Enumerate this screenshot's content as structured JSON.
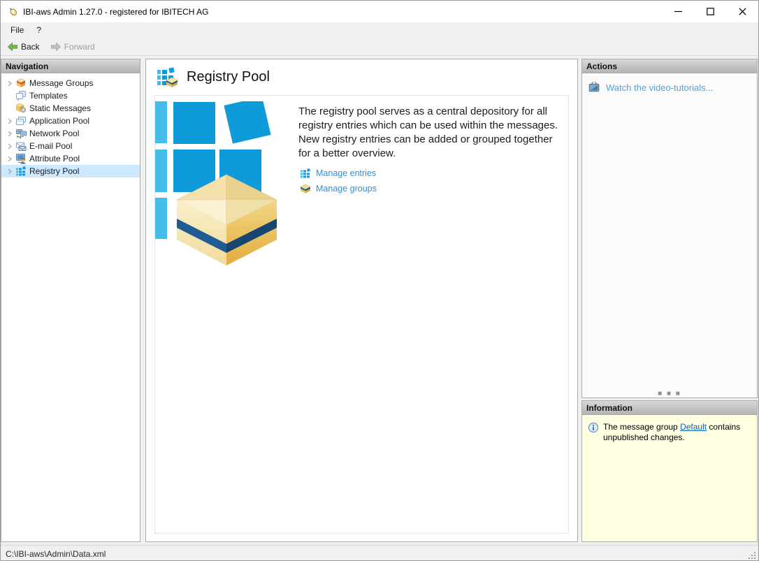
{
  "window": {
    "title": "IBI-aws Admin 1.27.0 - registered for IBITECH AG",
    "controls": {
      "minimize": "minimize",
      "maximize": "maximize",
      "close": "close"
    }
  },
  "menu": {
    "file": "File",
    "help": "?"
  },
  "toolbar": {
    "back_label": "Back",
    "forward_label": "Forward"
  },
  "navigation": {
    "header": "Navigation",
    "items": [
      {
        "label": "Message Groups",
        "icon": "message-groups-icon",
        "expandable": true,
        "selected": false
      },
      {
        "label": "Templates",
        "icon": "templates-icon",
        "expandable": false,
        "selected": false
      },
      {
        "label": "Static Messages",
        "icon": "static-messages-icon",
        "expandable": false,
        "selected": false
      },
      {
        "label": "Application Pool",
        "icon": "application-pool-icon",
        "expandable": true,
        "selected": false
      },
      {
        "label": "Network Pool",
        "icon": "network-pool-icon",
        "expandable": true,
        "selected": false
      },
      {
        "label": "E-mail Pool",
        "icon": "email-pool-icon",
        "expandable": true,
        "selected": false
      },
      {
        "label": "Attribute Pool",
        "icon": "attribute-pool-icon",
        "expandable": true,
        "selected": false
      },
      {
        "label": "Registry Pool",
        "icon": "registry-pool-icon",
        "expandable": true,
        "selected": true
      }
    ]
  },
  "main": {
    "title": "Registry Pool",
    "title_icon": "registry-pool-box-icon",
    "description": "The registry pool serves as a central depository for all registry entries which can be used within the messages. New registry entries can be added or grouped together for a better overview.",
    "links": [
      {
        "label": "Manage entries",
        "icon": "registry-tiles-icon"
      },
      {
        "label": "Manage groups",
        "icon": "group-box-icon"
      }
    ]
  },
  "actions": {
    "header": "Actions",
    "links": [
      {
        "label": "Watch the video-tutorials...",
        "icon": "tv-icon"
      }
    ]
  },
  "information": {
    "header": "Information",
    "text_before": "The message group ",
    "link_label": "Default",
    "text_after": " contains unpublished changes."
  },
  "statusbar": {
    "path": "C:\\IBI-aws\\Admin\\Data.xml"
  },
  "colors": {
    "tile_light_blue": "#45bce9",
    "tile_dark_blue": "#0f9ad9",
    "selection_bg": "#cde8ff",
    "manage_link_blue": "#2e8fd8",
    "actions_link_blue": "#52a3dd",
    "default_link_blue": "#0563c1",
    "info_bg": "#ffffe1",
    "box_navy_band": "#1f5c94",
    "box_gold": "#e5b44a"
  }
}
